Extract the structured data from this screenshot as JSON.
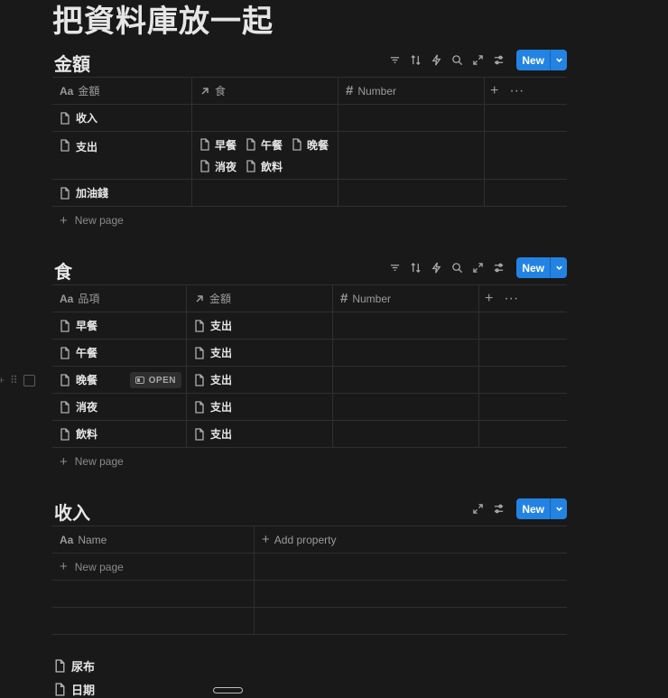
{
  "page": {
    "title": "把資料庫放一起"
  },
  "toolbar": {
    "new_label": "New"
  },
  "db1": {
    "title": "金額",
    "columns": [
      "金額",
      "食",
      "Number"
    ],
    "rows": [
      {
        "name": "收入",
        "links": []
      },
      {
        "name": "支出",
        "links": [
          "早餐",
          "午餐",
          "晚餐",
          "消夜",
          "飲料"
        ]
      },
      {
        "name": "加油錢",
        "links": []
      }
    ],
    "new_page": "New page"
  },
  "db2": {
    "title": "食",
    "columns": [
      "品項",
      "金額",
      "Number"
    ],
    "rows": [
      {
        "name": "早餐",
        "link": "支出"
      },
      {
        "name": "午餐",
        "link": "支出"
      },
      {
        "name": "晚餐",
        "link": "支出",
        "open": "OPEN"
      },
      {
        "name": "消夜",
        "link": "支出"
      },
      {
        "name": "飲料",
        "link": "支出"
      }
    ],
    "new_page": "New page"
  },
  "db3": {
    "title": "收入",
    "columns": [
      "Name"
    ],
    "add_property": "Add property",
    "new_page": "New page"
  },
  "pages": [
    "尿布",
    "日期"
  ],
  "icons": {
    "filter": "filter-icon",
    "sort": "sort-icon",
    "automation": "lightning-icon",
    "search": "search-icon",
    "expand": "expand-icon",
    "settings": "sliders-icon",
    "caret": "chevron-down-icon",
    "doc": "page-icon"
  },
  "colors": {
    "background": "#191919",
    "accent": "#2383e2",
    "text": "#e6e6e6",
    "muted": "#9b9b9b"
  }
}
